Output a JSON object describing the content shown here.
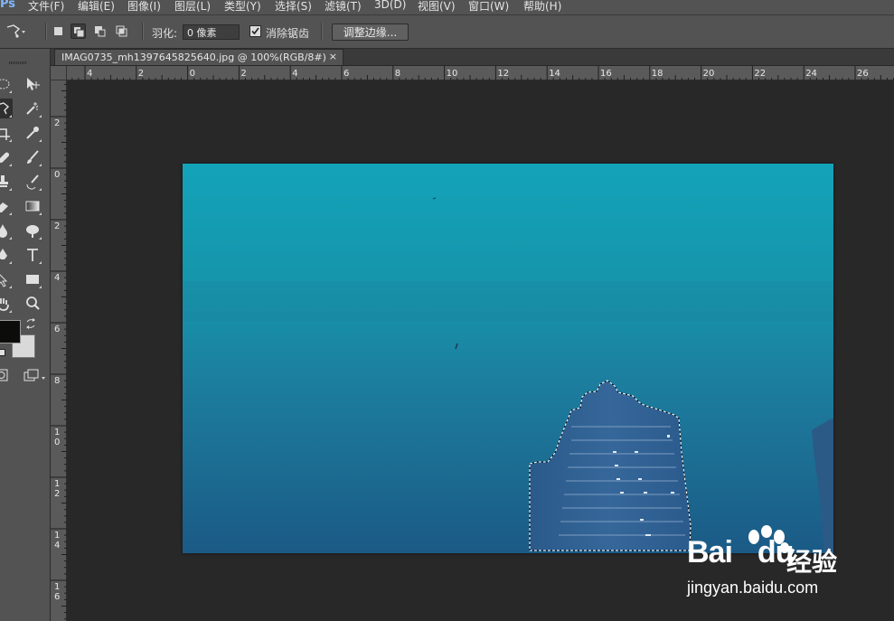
{
  "app": {
    "logo": "Ps"
  },
  "menu": [
    "文件(F)",
    "编辑(E)",
    "图像(I)",
    "图层(L)",
    "类型(Y)",
    "选择(S)",
    "滤镜(T)",
    "3D(D)",
    "视图(V)",
    "窗口(W)",
    "帮助(H)"
  ],
  "options": {
    "feather_label": "羽化:",
    "feather_value": "0 像素",
    "antialias_label": "消除锯齿",
    "antialias_checked": true,
    "refine_edge_label": "调整边缘..."
  },
  "document": {
    "tab_title": "IMAG0735_mh1397645825640.jpg @ 100%(RGB/8#)",
    "close_glyph": "×"
  },
  "ruler": {
    "horizontal_labels": [
      "4",
      "2",
      "0",
      "2",
      "4",
      "6",
      "8",
      "10",
      "12",
      "14",
      "16",
      "18",
      "20",
      "22",
      "24",
      "26"
    ],
    "vertical_labels": [
      "2",
      "0",
      "2",
      "4",
      "6",
      "8",
      "1\n0",
      "1\n2",
      "1\n4",
      "1\n6"
    ]
  },
  "tools": [
    "lasso-polygon",
    "move",
    "ellipse-marquee",
    "magic-wand",
    "crop",
    "eyedropper",
    "healing",
    "brush",
    "stamp",
    "history-brush",
    "eraser",
    "gradient",
    "blur",
    "dodge",
    "pen",
    "type",
    "path-select",
    "rectangle",
    "hand",
    "zoom"
  ],
  "colors": {
    "foreground": "#0c0c0a",
    "background": "#d9d9d9",
    "sky_top": "#13a3b9",
    "sky_bottom": "#1b5a86"
  },
  "watermark": {
    "baidu": "Bai",
    "du": "du",
    "jingyan": "经验",
    "url": "jingyan.baidu.com"
  }
}
